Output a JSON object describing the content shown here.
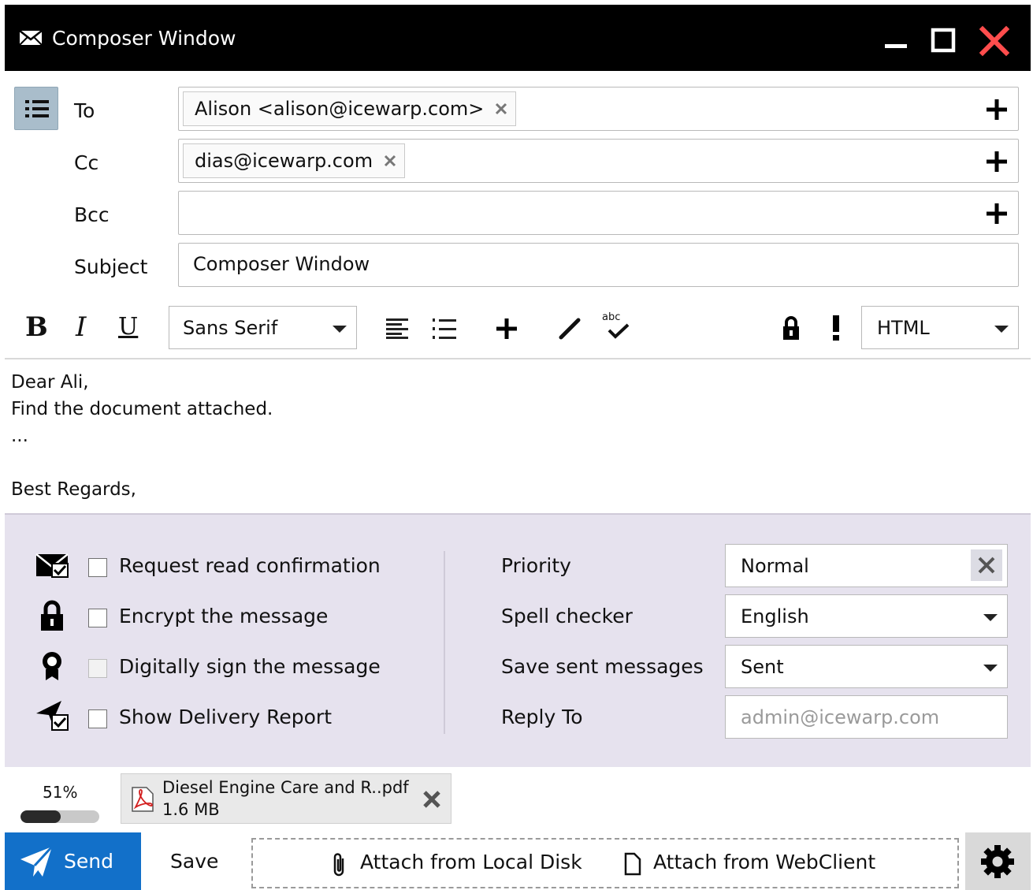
{
  "window": {
    "title": "Composer Window"
  },
  "header": {
    "to_label": "To",
    "cc_label": "Cc",
    "bcc_label": "Bcc",
    "subject_label": "Subject",
    "to_chip": "Alison <alison@icewarp.com>",
    "cc_chip": "dias@icewarp.com",
    "subject_value": "Composer Window"
  },
  "toolbar": {
    "bold": "B",
    "italic": "I",
    "underline": "U",
    "font": "Sans Serif",
    "format": "HTML",
    "abc": "abc"
  },
  "body": {
    "lines": [
      "Dear Ali,",
      "Find the document attached.",
      "...",
      "",
      "Best Regards,"
    ]
  },
  "options": {
    "read_confirmation": "Request read confirmation",
    "encrypt": "Encrypt the message",
    "sign": "Digitally sign the message",
    "delivery_report": "Show Delivery Report",
    "priority_label": "Priority",
    "priority_value": "Normal",
    "spell_label": "Spell checker",
    "spell_value": "English",
    "save_sent_label": "Save sent messages",
    "save_sent_value": "Sent",
    "reply_to_label": "Reply To",
    "reply_to_placeholder": "admin@icewarp.com"
  },
  "attachments": {
    "progress_text": "51%",
    "progress_fraction": 0.51,
    "file_name": "Diesel Engine Care and R..pdf",
    "file_size": "1.6 MB"
  },
  "footer": {
    "send": "Send",
    "save": "Save",
    "attach_local": "Attach from Local Disk",
    "attach_webclient": "Attach from WebClient"
  },
  "icons": {
    "mail": "mail-icon",
    "list": "list-icon",
    "lock": "lock-icon",
    "priority": "exclamation-icon",
    "gear": "gear-icon"
  },
  "colors": {
    "titlebar": "#000000",
    "close": "#ff4d4d",
    "send": "#1270c9",
    "options_bg": "#e6e2ee"
  }
}
